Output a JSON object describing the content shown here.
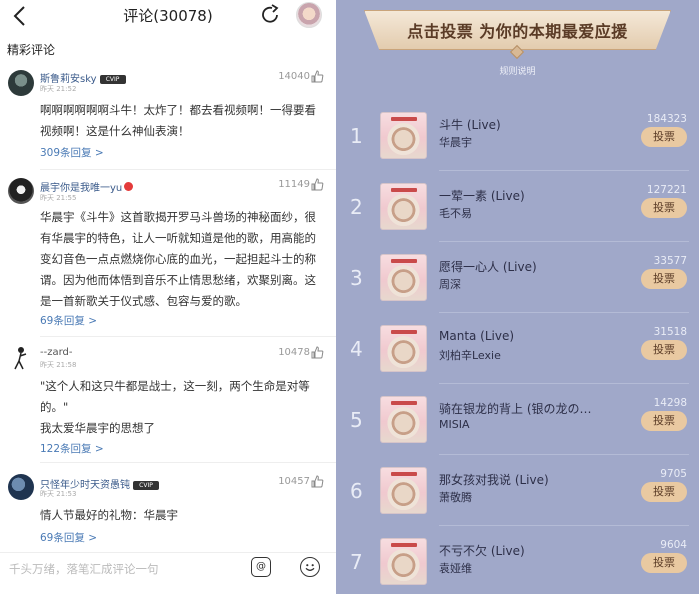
{
  "left": {
    "header": {
      "title": "评论(30078)",
      "back_icon": "chevron-left-icon",
      "share_icon": "share-icon"
    },
    "section_title": "精彩评论",
    "comments": [
      {
        "name": "斯鲁莉安sky",
        "vip": "CVIP",
        "time": "昨天 21:52",
        "likes": "14040",
        "text": "啊啊啊啊啊啊斗牛！太炸了！都去看视频啊！一得要看视频啊！这是什么神仙表演！",
        "replies": "309条回复 >"
      },
      {
        "name": "晨宇你是我唯一yu",
        "vip": "",
        "time": "昨天 21:55",
        "likes": "11149",
        "text": "华晨宇《斗牛》这首歌揭开罗马斗兽场的神秘面纱，很有华晨宇的特色，让人一听就知道是他的歌，用高能的变幻音色一点点燃烧你心底的血光，一起担起斗士的称谓。因为他而体悟到音乐不止情思愁绪，欢聚别离。这是一首新歌关于仪式感、包容与爱的歌。",
        "replies": "69条回复 >"
      },
      {
        "name": "--zard-",
        "vip": "",
        "time": "昨天 21:58",
        "likes": "10478",
        "text": "\"这个人和这只牛都是战士，这一刻，两个生命是对等的。\"\n我太爱华晨宇的思想了",
        "replies": "122条回复 >"
      },
      {
        "name": "只怪年少时天资愚钝",
        "vip": "CVIP",
        "time": "昨天 21:53",
        "likes": "10457",
        "text": "情人节最好的礼物：华晨宇",
        "replies": "69条回复 >"
      }
    ],
    "input": {
      "placeholder": "千头万绪，落笔汇成评论一句",
      "at_label": "@",
      "emoji_icon": "emoji-icon"
    }
  },
  "right": {
    "banner": "点击投票 为你的本期最爱应援",
    "rules": "规则说明",
    "vote_label": "投票",
    "songs": [
      {
        "rank": "1",
        "title": "斗牛 (Live)",
        "artist": "华晨宇",
        "votes": "184323"
      },
      {
        "rank": "2",
        "title": "一荤一素 (Live)",
        "artist": "毛不易",
        "votes": "127221"
      },
      {
        "rank": "3",
        "title": "愿得一心人 (Live)",
        "artist": "周深",
        "votes": "33577"
      },
      {
        "rank": "4",
        "title": "Manta (Live)",
        "artist": "刘柏辛Lexie",
        "votes": "31518"
      },
      {
        "rank": "5",
        "title": "骑在银龙的背上 (银の龙の…",
        "artist": "MISIA",
        "votes": "14298"
      },
      {
        "rank": "6",
        "title": "那女孩对我说 (Live)",
        "artist": "萧敬腾",
        "votes": "9705"
      },
      {
        "rank": "7",
        "title": "不亏不欠 (Live)",
        "artist": "袁娅维",
        "votes": "9604"
      }
    ]
  },
  "colors": {
    "right_bg": "#a0a8c9",
    "vote_button": "#e9c9a1",
    "link_blue": "#4a7ab5"
  }
}
